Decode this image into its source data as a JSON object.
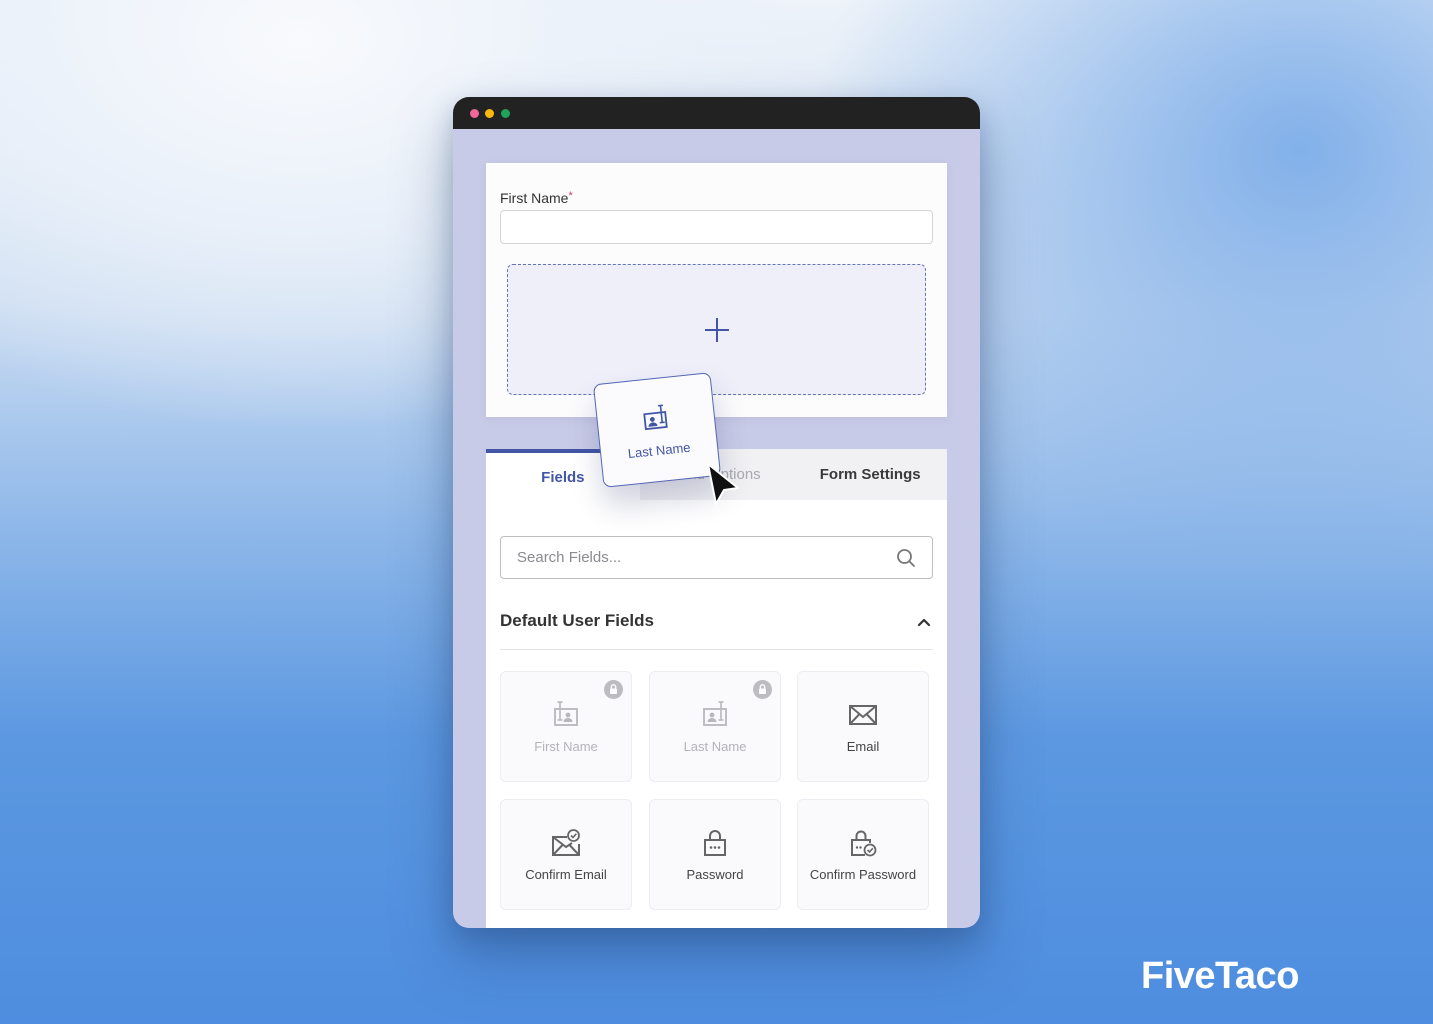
{
  "window": {
    "controls": [
      "close",
      "minimize",
      "maximize"
    ],
    "colors": {
      "close": "#f2679a",
      "minimize": "#f8b90c",
      "maximize": "#1ea35a"
    }
  },
  "form": {
    "first_name_label": "First Name",
    "required_marker": "*",
    "first_name_value": "",
    "drop_zone_icon": "plus-icon"
  },
  "drag": {
    "label": "Last Name",
    "icon": "id-card-icon"
  },
  "tabs": [
    {
      "label": "Fields",
      "active": true
    },
    {
      "label": "Field Options",
      "active": false
    },
    {
      "label": "Form Settings",
      "active": false
    }
  ],
  "search": {
    "placeholder": "Search Fields...",
    "value": ""
  },
  "section": {
    "title": "Default User Fields",
    "expanded": true
  },
  "fields": [
    {
      "label": "First Name",
      "icon": "id-card-icon",
      "locked": true
    },
    {
      "label": "Last Name",
      "icon": "id-card-icon",
      "locked": true
    },
    {
      "label": "Email",
      "icon": "envelope-icon",
      "locked": false
    },
    {
      "label": "Confirm Email",
      "icon": "envelope-check-icon",
      "locked": false
    },
    {
      "label": "Password",
      "icon": "lock-dots-icon",
      "locked": false
    },
    {
      "label": "Confirm Password",
      "icon": "lock-check-icon",
      "locked": false
    }
  ],
  "accent_color": "#4256a6",
  "brand": {
    "name": "FiveTaco"
  }
}
